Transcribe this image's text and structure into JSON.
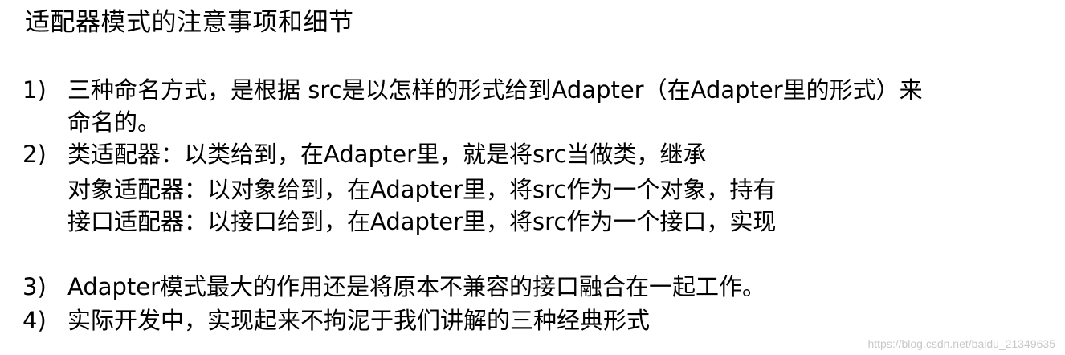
{
  "title": "适配器模式的注意事项和细节",
  "items": [
    {
      "num": "1)",
      "lines": [
        "三种命名方式，是根据 src是以怎样的形式给到Adapter（在Adapter里的形式）来",
        "命名的。"
      ]
    },
    {
      "num": "2)",
      "lines": [
        "类适配器：以类给到，在Adapter里，就是将src当做类，继承",
        "对象适配器：以对象给到，在Adapter里，将src作为一个对象，持有",
        "接口适配器：以接口给到，在Adapter里，将src作为一个接口，实现"
      ]
    },
    {
      "num": "3)",
      "lines": [
        "Adapter模式最大的作用还是将原本不兼容的接口融合在一起工作。"
      ]
    },
    {
      "num": "4)",
      "lines": [
        "实际开发中，实现起来不拘泥于我们讲解的三种经典形式"
      ]
    }
  ],
  "watermark": "https://blog.csdn.net/baidu_21349635"
}
